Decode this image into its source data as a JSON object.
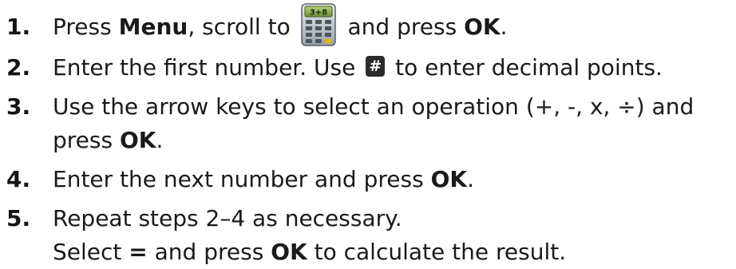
{
  "steps": [
    {
      "number": "1.",
      "t1": "Press ",
      "b1": "Menu",
      "t2": ", scroll to ",
      "icon_label": "3+8",
      "icon": "calculator-icon",
      "t3": " and press ",
      "b2": "OK",
      "t4": "."
    },
    {
      "number": "2.",
      "t1": "Enter the first number. Use ",
      "key": "#",
      "icon": "hash-key-icon",
      "t2": " to enter decimal points."
    },
    {
      "number": "3.",
      "line1": "Use the arrow keys to select an operation (+, -, x, ÷) and",
      "t1": "press ",
      "b1": "OK",
      "t2": "."
    },
    {
      "number": "4.",
      "t1": "Enter the next number and press ",
      "b1": "OK",
      "t2": "."
    },
    {
      "number": "5.",
      "line1": "Repeat steps 2–4 as necessary.",
      "t1": "Select ",
      "b1": "=",
      "t2": " and press ",
      "b2": "OK",
      "t3": " to calculate the result."
    }
  ],
  "colors": {
    "text": "#1a1a1a",
    "key_bg": "#2b2b2b",
    "icon_green": "#6b8f3a",
    "icon_body": "#c8ccd0",
    "icon_accent": "#e8b400"
  }
}
